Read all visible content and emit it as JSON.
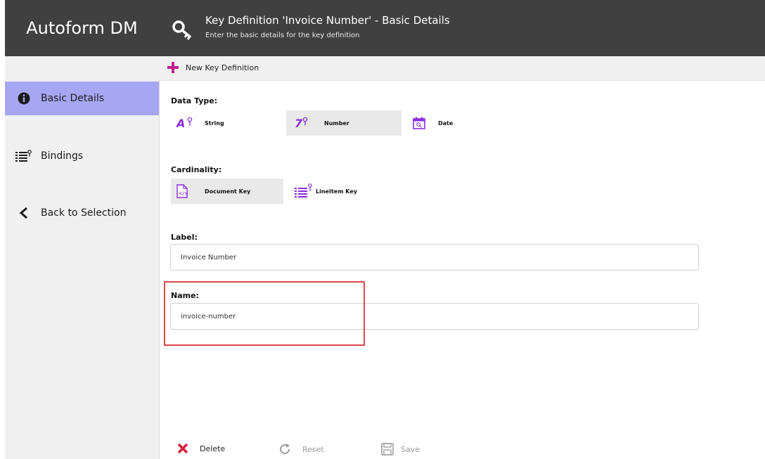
{
  "app": {
    "title": "Autoform DM"
  },
  "header": {
    "title": "Key Definition 'Invoice Number' - Basic Details",
    "subtitle": "Enter the basic details for the key definition",
    "icon": "key-search-icon"
  },
  "toolbar": {
    "new_label": "New Key Definition"
  },
  "sidebar": {
    "items": [
      {
        "label": "Basic Details",
        "icon": "info-icon",
        "active": true
      },
      {
        "label": "Bindings",
        "icon": "bindings-list-icon",
        "active": false
      },
      {
        "label": "Back to Selection",
        "icon": "back-chevron-icon",
        "active": false
      }
    ]
  },
  "form": {
    "data_type": {
      "label": "Data Type:",
      "options": [
        {
          "label": "String",
          "icon": "string-type-icon",
          "selected": false
        },
        {
          "label": "Number",
          "icon": "number-type-icon",
          "selected": true
        },
        {
          "label": "Date",
          "icon": "date-type-icon",
          "selected": false
        }
      ]
    },
    "cardinality": {
      "label": "Cardinality:",
      "options": [
        {
          "label": "Document Key",
          "icon": "document-key-icon",
          "selected": true
        },
        {
          "label": "LineItem Key",
          "icon": "lineitem-key-icon",
          "selected": false
        }
      ]
    },
    "label_field": {
      "label": "Label:",
      "value": "Invoice Number"
    },
    "name_field": {
      "label": "Name:",
      "value": "invoice-number"
    }
  },
  "actions": {
    "delete": "Delete",
    "reset": "Reset",
    "save": "Save"
  },
  "colors": {
    "header_bg": "#404040",
    "sidebar_bg": "#f0f0f0",
    "active_item": "#a7a6f3",
    "accent_purple": "#8a2be2",
    "accent_magenta": "#c0208f",
    "delete_red": "#d81b3c",
    "highlight_red": "#e0474b"
  }
}
